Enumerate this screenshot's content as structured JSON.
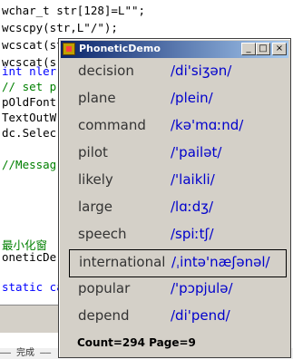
{
  "editor": {
    "lines": [
      {
        "text": "wchar_t str[128]=L\"\";"
      },
      {
        "text": "wcscpy(str,L\"/\");"
      },
      {
        "text": "wcscat(str,p->di);"
      },
      {
        "text": "wcscat(s"
      },
      {
        "text": "int nler"
      },
      {
        "text": "// set p"
      },
      {
        "text": "pOldFont"
      },
      {
        "text": "TextOutW"
      },
      {
        "text": "dc.Selec"
      },
      {
        "text": ""
      },
      {
        "text": "//Messag"
      },
      {
        "text": ""
      },
      {
        "text": ""
      },
      {
        "text": "最小化窗"
      },
      {
        "text": "oneticDe"
      },
      {
        "text": ""
      },
      {
        "text": "static ca"
      }
    ],
    "status_text": "—— 完成 ——"
  },
  "window": {
    "title": "PhoneticDemo",
    "buttons": {
      "minimize": "_",
      "maximize": "□",
      "close": "×"
    },
    "entries": [
      {
        "word": "decision",
        "phonetic": "/di'siʒən/"
      },
      {
        "word": "plane",
        "phonetic": "/plein/"
      },
      {
        "word": "command",
        "phonetic": "/kə'mɑːnd/"
      },
      {
        "word": "pilot",
        "phonetic": "/'pailət/"
      },
      {
        "word": "likely",
        "phonetic": "/'laikli/"
      },
      {
        "word": "large",
        "phonetic": "/lɑːdʒ/"
      },
      {
        "word": "speech",
        "phonetic": "/spiːtʃ/"
      },
      {
        "word": "international",
        "phonetic": "/ˌintə'næʃənəl/"
      },
      {
        "word": "popular",
        "phonetic": "/'pɔpjulə/"
      },
      {
        "word": "depend",
        "phonetic": "/di'pend/"
      }
    ],
    "selected_word": "international",
    "footer": "Count=294 Page=9"
  }
}
